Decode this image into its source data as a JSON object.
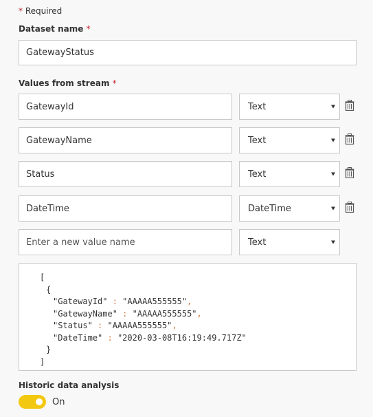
{
  "required_note": {
    "star": "*",
    "text": "Required"
  },
  "dataset_name": {
    "label": "Dataset name",
    "required_star": "*",
    "value": "GatewayStatus"
  },
  "values_from_stream": {
    "label": "Values from stream",
    "required_star": "*",
    "rows": [
      {
        "name": "GatewayId",
        "type": "Text"
      },
      {
        "name": "GatewayName",
        "type": "Text"
      },
      {
        "name": "Status",
        "type": "Text"
      },
      {
        "name": "DateTime",
        "type": "DateTime"
      }
    ],
    "new_row": {
      "placeholder": "Enter a new value name",
      "type": "Text"
    }
  },
  "json_preview": {
    "open_bracket": "[",
    "open_brace": "{",
    "entries": [
      {
        "key": "\"GatewayId\"",
        "sep": " : ",
        "value": "\"AAAAA555555\"",
        "comma": ","
      },
      {
        "key": "\"GatewayName\"",
        "sep": " : ",
        "value": "\"AAAAA555555\"",
        "comma": ","
      },
      {
        "key": "\"Status\"",
        "sep": " : ",
        "value": "\"AAAAA555555\"",
        "comma": ","
      },
      {
        "key": "\"DateTime\"",
        "sep": " : ",
        "value": "\"2020-03-08T16:19:49.717Z\"",
        "comma": ""
      }
    ],
    "close_brace": "}",
    "close_bracket": "]"
  },
  "historic_data": {
    "label": "Historic data analysis",
    "enabled": true,
    "state_label": "On",
    "accent_color": "#f2c811"
  }
}
